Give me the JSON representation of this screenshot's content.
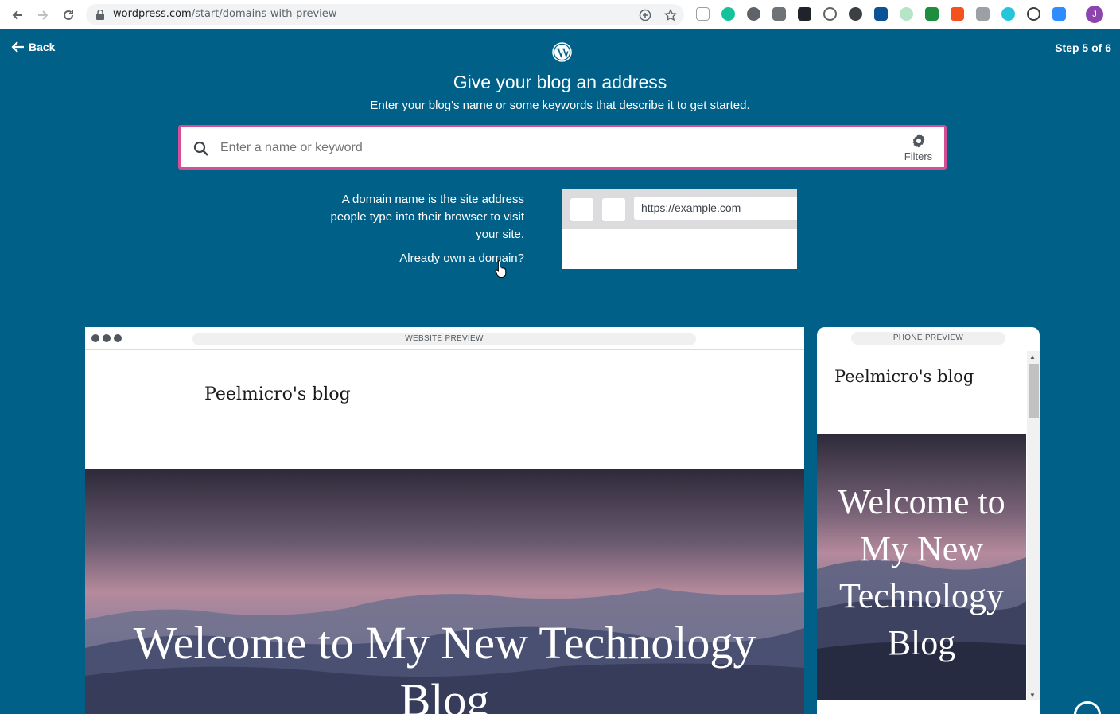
{
  "browser": {
    "url_domain": "wordpress.com",
    "url_path": "/start/domains-with-preview",
    "profile_initial": "J"
  },
  "header": {
    "back_label": "Back",
    "step_label": "Step 5 of 6"
  },
  "main": {
    "title": "Give your blog an address",
    "subtitle": "Enter your blog's name or some keywords that describe it to get started.",
    "search_placeholder": "Enter a name or keyword",
    "filters_label": "Filters",
    "explain_text": "A domain name is the site address people type into their browser to visit your site.",
    "own_domain_link": "Already own a domain?",
    "example_url": "https://example.com"
  },
  "website_preview": {
    "label": "WEBSITE PREVIEW",
    "blog_name": "Peelmicro's blog",
    "hero_text": "Welcome to My New Technology Blog"
  },
  "phone_preview": {
    "label": "PHONE PREVIEW",
    "blog_name": "Peelmicro's blog",
    "hero_text": "Welcome to My New Technology Blog"
  },
  "colors": {
    "background": "#016087",
    "search_border": "#d54e93"
  }
}
